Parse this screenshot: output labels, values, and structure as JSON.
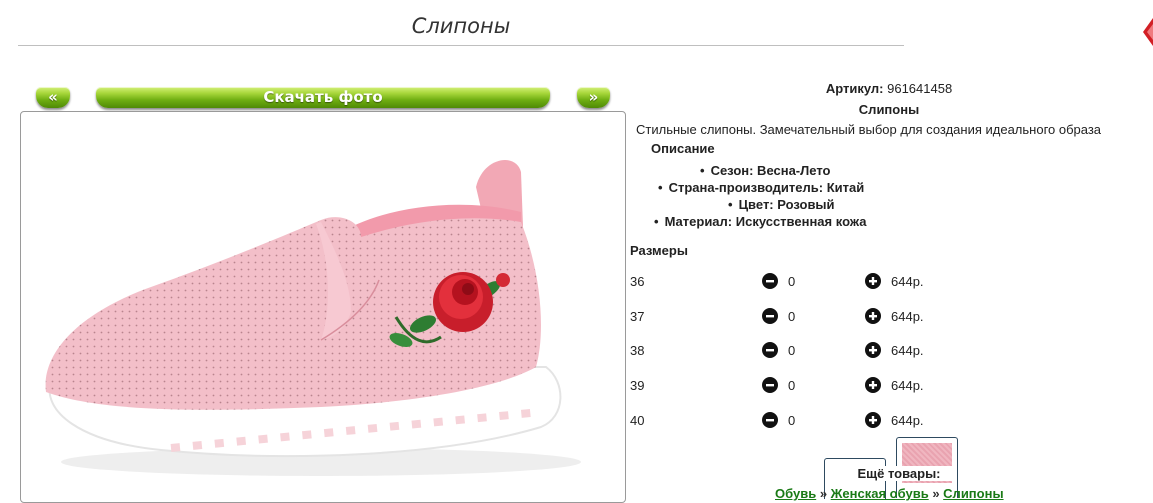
{
  "page": {
    "title": "Слипоны"
  },
  "nav": {
    "prev_label": "«",
    "next_label": "»",
    "download_label": "Скачать фото"
  },
  "product": {
    "article_label": "Артикул:",
    "article_value": "961641458",
    "name": "Слипоны",
    "description": "Стильные слипоны. Замечательный выбор для создания идеального образа",
    "description_heading": "Описание",
    "features": [
      "Сезон: Весна-Лето",
      "Страна-производитель: Китай",
      "Цвет: Розовый",
      "Материал: Искусственная кожа"
    ]
  },
  "sizes": {
    "heading": "Размеры",
    "rows": [
      {
        "size": "36",
        "qty": "0",
        "price": "644р."
      },
      {
        "size": "37",
        "qty": "0",
        "price": "644р."
      },
      {
        "size": "38",
        "qty": "0",
        "price": "644р."
      },
      {
        "size": "39",
        "qty": "0",
        "price": "644р."
      },
      {
        "size": "40",
        "qty": "0",
        "price": "644р."
      }
    ]
  },
  "more": {
    "label": "Ещё товары:",
    "breadcrumbs": [
      "Обувь",
      "Женская обувь",
      "Слипоны"
    ],
    "separator": "»"
  },
  "icons": {
    "minus": "minus-circle-icon",
    "plus": "plus-circle-icon",
    "corner": "red-arrow-icon"
  },
  "colors": {
    "button_green": "#6fae12",
    "link_green": "#1a7a16",
    "shoe_pink": "#f3bfc9",
    "rose_red": "#d9202c"
  }
}
